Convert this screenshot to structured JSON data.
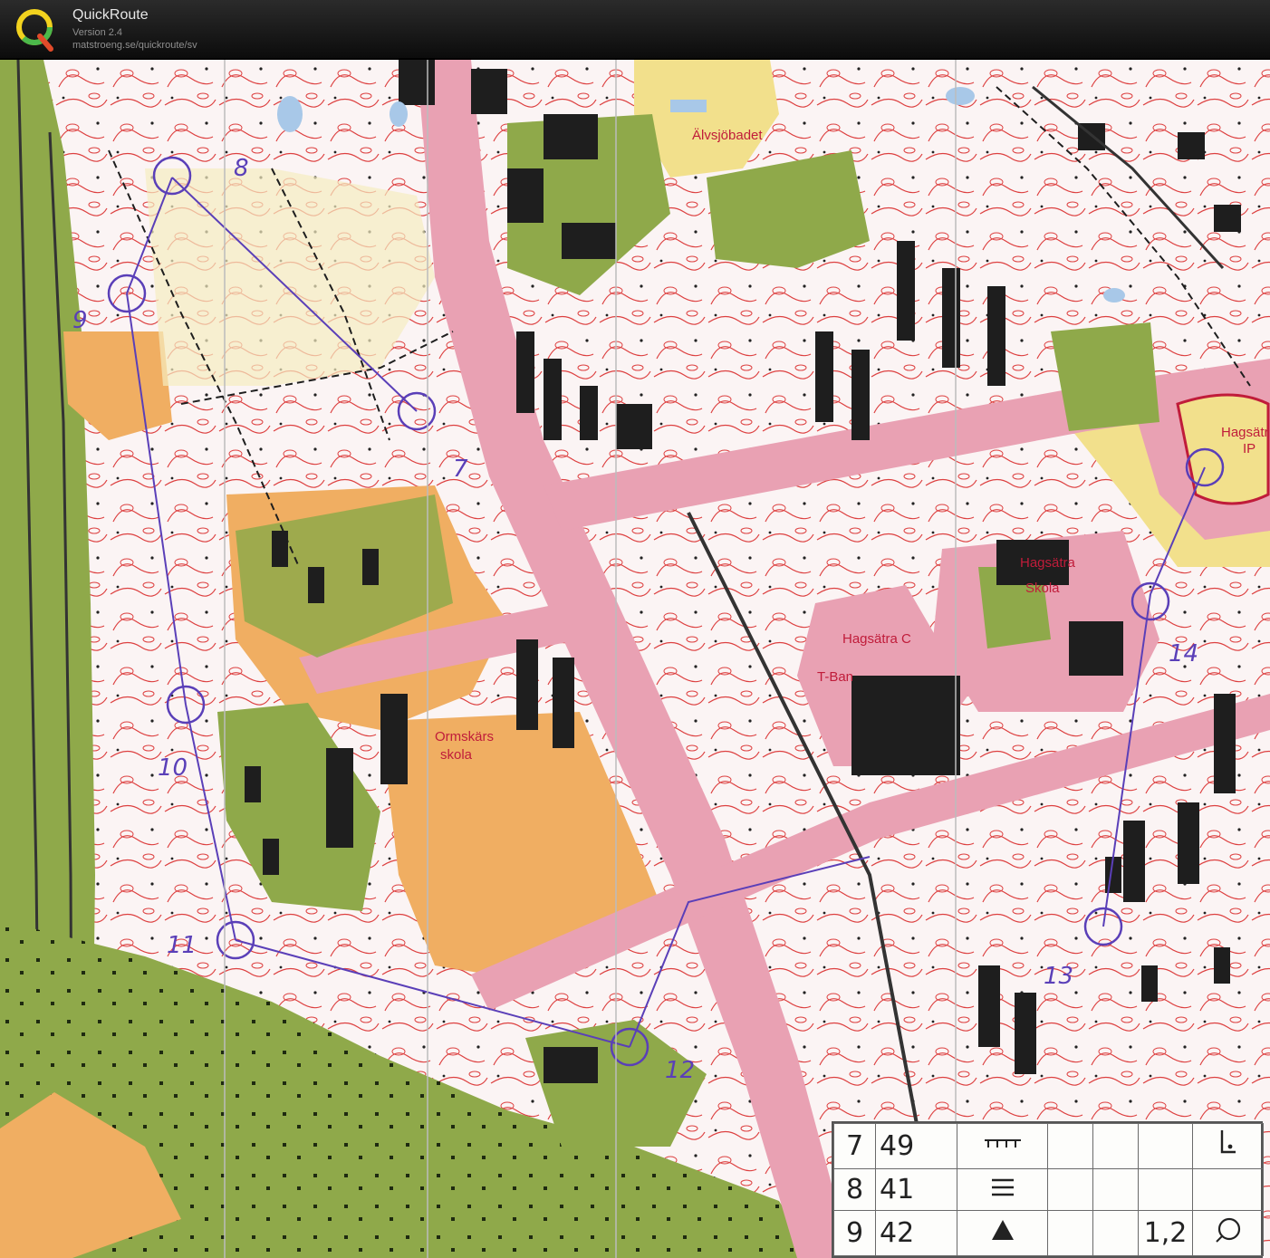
{
  "header": {
    "app_name": "QuickRoute",
    "version": "Version 2.4",
    "url": "matstroeng.se/quickroute/sv"
  },
  "map": {
    "labels": {
      "alvsjobadet": "Älvsjöbadet",
      "hagsatra_ip_1": "Hagsätr",
      "hagsatra_ip_2": "IP",
      "hagsatra_skola_1": "Hagsätra",
      "hagsatra_skola_2": "Skola",
      "hagsatra_c": "Hagsätra C",
      "tbana": "T-Ban",
      "ormskars_1": "Ormskärs",
      "ormskars_2": "skola"
    },
    "controls": [
      "7",
      "8",
      "9",
      "10",
      "11",
      "12",
      "13",
      "14"
    ]
  },
  "legend": {
    "rows": [
      {
        "num": "7",
        "code": "49",
        "symbol": "ruler-fence-icon",
        "dim": "",
        "extra": "corner-icon"
      },
      {
        "num": "8",
        "code": "41",
        "symbol": "triple-line-icon",
        "dim": "",
        "extra": ""
      },
      {
        "num": "9",
        "code": "42",
        "symbol": "triangle-icon",
        "dim": "1,2",
        "extra": "circle-icon"
      }
    ]
  },
  "colors": {
    "forest_green": "#8fa94a",
    "open_yellow": "#f2e08c",
    "rough_orange": "#f0ae62",
    "paved_pink": "#e9a1b3",
    "contour_red": "#d83a3a",
    "course_purple": "#5a3fb8"
  }
}
